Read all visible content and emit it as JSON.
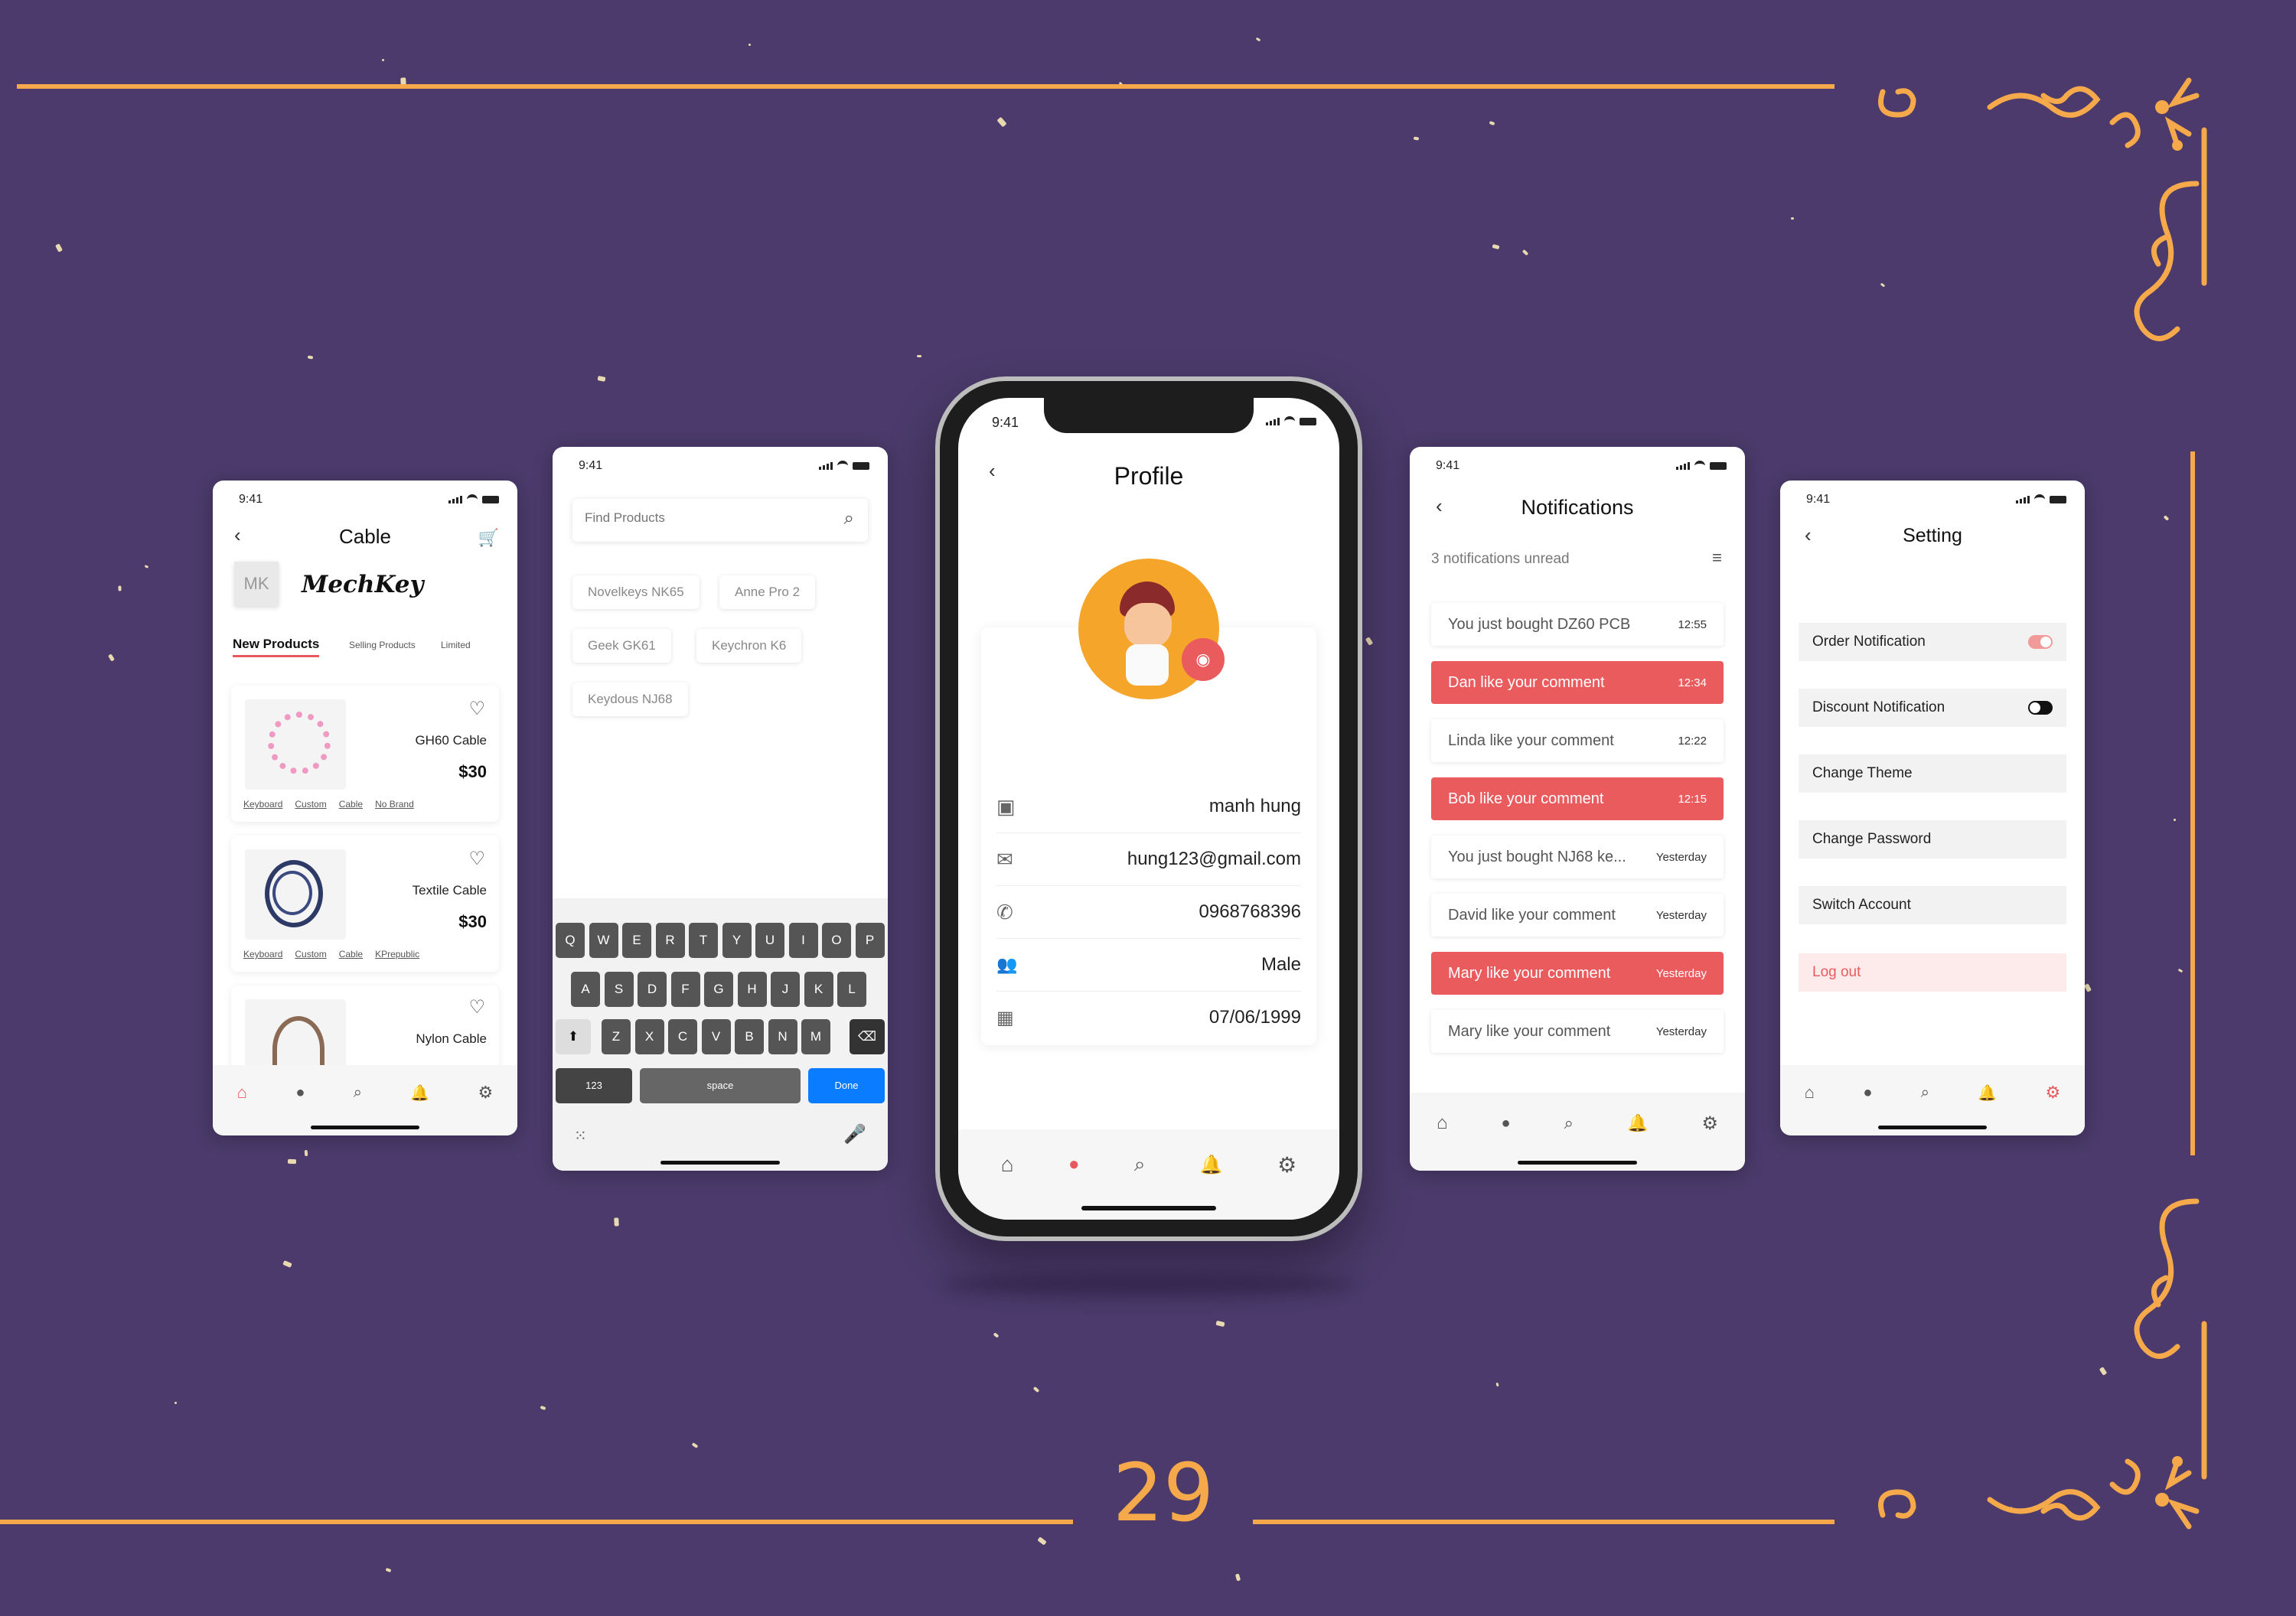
{
  "page_number": "29",
  "colors": {
    "background": "#4b3a6b",
    "gold": "#f5a94a",
    "accent_red": "#ea5b5e",
    "key_blue": "#0a7cff"
  },
  "status_time": "9:41",
  "cable": {
    "title": "Cable",
    "logo_badge": "MK",
    "brand": "MechKey",
    "tabs": [
      "New Products",
      "Selling Products",
      "Limited"
    ],
    "products": [
      {
        "name": "GH60 Cable",
        "price": "$30",
        "tags": [
          "Keyboard",
          "Custom",
          "Cable",
          "No Brand"
        ]
      },
      {
        "name": "Textile Cable",
        "price": "$30",
        "tags": [
          "Keyboard",
          "Custom",
          "Cable",
          "KPrepublic"
        ]
      },
      {
        "name": "Nylon Cable",
        "price": "",
        "tags": []
      }
    ]
  },
  "search": {
    "placeholder": "Find Products",
    "chips": [
      "Novelkeys NK65",
      "Anne Pro 2",
      "Geek GK61",
      "Keychron K6",
      "Keydous NJ68"
    ],
    "keys_row1": [
      "Q",
      "W",
      "E",
      "R",
      "T",
      "Y",
      "U",
      "I",
      "O",
      "P"
    ],
    "keys_row2": [
      "A",
      "S",
      "D",
      "F",
      "G",
      "H",
      "J",
      "K",
      "L"
    ],
    "keys_row3": [
      "Z",
      "X",
      "C",
      "V",
      "B",
      "N",
      "M"
    ],
    "key_123": "123",
    "key_space": "space",
    "key_done": "Done"
  },
  "profile": {
    "title": "Profile",
    "fields": [
      {
        "icon": "contact-card-icon",
        "value": "manh hung"
      },
      {
        "icon": "mail-icon",
        "value": "hung123@gmail.com"
      },
      {
        "icon": "phone-icon",
        "value": "0968768396"
      },
      {
        "icon": "people-icon",
        "value": "Male"
      },
      {
        "icon": "calendar-icon",
        "value": "07/06/1999"
      }
    ]
  },
  "notifications": {
    "title": "Notifications",
    "unread": "3 notifications unread",
    "items": [
      {
        "text": "You just bought DZ60 PCB",
        "time": "12:55",
        "highlight": false
      },
      {
        "text": "Dan like your comment",
        "time": "12:34",
        "highlight": true
      },
      {
        "text": "Linda like your comment",
        "time": "12:22",
        "highlight": false
      },
      {
        "text": "Bob like your comment",
        "time": "12:15",
        "highlight": true
      },
      {
        "text": "You just bought NJ68 ke...",
        "time": "Yesterday",
        "highlight": false
      },
      {
        "text": "David like your comment",
        "time": "Yesterday",
        "highlight": false
      },
      {
        "text": "Mary like your comment",
        "time": "Yesterday",
        "highlight": true
      },
      {
        "text": "Mary like your comment",
        "time": "Yesterday",
        "highlight": false
      }
    ]
  },
  "setting": {
    "title": "Setting",
    "items": [
      {
        "label": "Order Notification",
        "toggle": "on"
      },
      {
        "label": "Discount Notification",
        "toggle": "off"
      },
      {
        "label": "Change Theme"
      },
      {
        "label": "Change Password"
      },
      {
        "label": "Switch Account"
      },
      {
        "label": "Log out",
        "danger": true
      }
    ]
  }
}
